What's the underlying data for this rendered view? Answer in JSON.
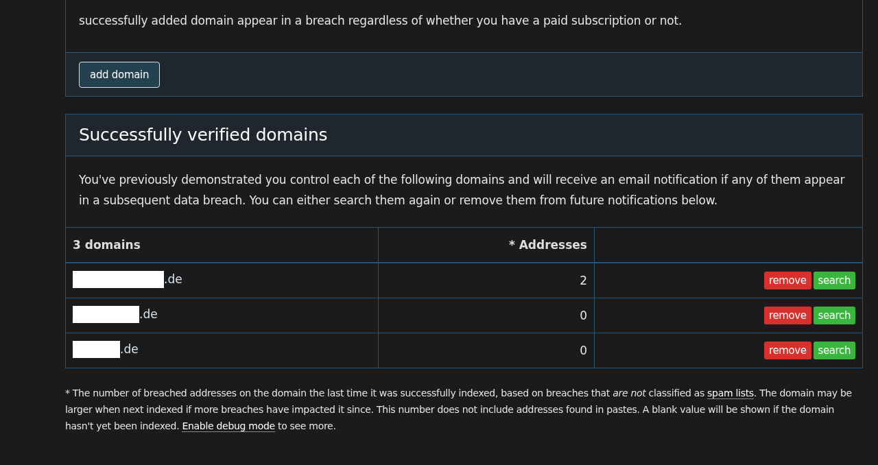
{
  "add_domain_card": {
    "text_tail": "successfully added domain appear in a breach regardless of whether you have a paid subscription or not.",
    "button": "add domain"
  },
  "verified": {
    "title": "Successfully verified domains",
    "intro": "You've previously demonstrated you control each of the following domains and will receive an email notification if any of them appear in a subsequent data breach. You can either search them again or remove them from future notifications below.",
    "table": {
      "columns": [
        "3 domains",
        "* Addresses"
      ],
      "rows": [
        {
          "domain": ".de",
          "addresses": "2",
          "actions": [
            "remove",
            "search"
          ]
        },
        {
          "domain": ".de",
          "addresses": "0",
          "actions": [
            "remove",
            "search"
          ]
        },
        {
          "domain": ".de",
          "addresses": "0",
          "actions": [
            "remove",
            "search"
          ]
        }
      ]
    }
  },
  "footnote": [
    {
      "kind": "text",
      "text": "* The number of breached addresses on the domain the last time it was successfully indexed, based on breaches that "
    },
    {
      "kind": "italic",
      "text": "are not"
    },
    {
      "kind": "text",
      "text": " classified as "
    },
    {
      "kind": "link",
      "text": "spam lists"
    },
    {
      "kind": "text",
      "text": ". The domain may be larger when next indexed if more breaches have impacted it since. This number does not include addresses found in pastes. A blank value will be shown if the domain hasn't yet been indexed. "
    },
    {
      "kind": "link",
      "text": "Enable debug mode"
    },
    {
      "kind": "text",
      "text": " to see more."
    }
  ]
}
